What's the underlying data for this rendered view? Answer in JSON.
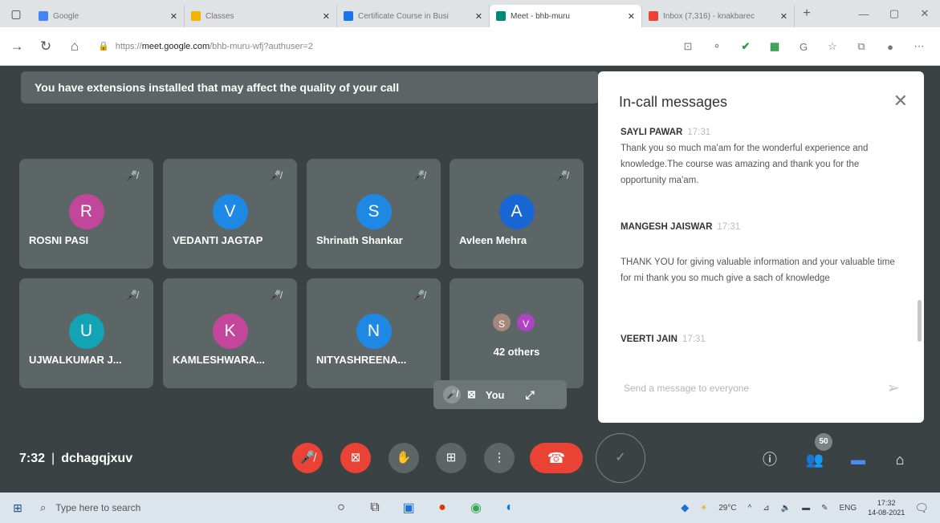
{
  "browser": {
    "tabs": [
      {
        "label": "Google",
        "color": "#4285f4",
        "active": false
      },
      {
        "label": "Classes",
        "color": "#f4b400",
        "active": false
      },
      {
        "label": "Certificate Course in Busi",
        "color": "#1a73e8",
        "active": false
      },
      {
        "label": "Meet - bhb-muru",
        "color": "#00897b",
        "active": true
      },
      {
        "label": "Inbox (7,316) - knakbarec",
        "color": "#ea4335",
        "active": false
      }
    ],
    "new_tab_label": "+",
    "url_prefix": "https://",
    "url_host": "meet.google.com",
    "url_path": "/bhb-muru-wfj?authuser=2"
  },
  "meet": {
    "extension_warning": "You have extensions installed that may affect the quality of your call",
    "participants": [
      {
        "initial": "R",
        "name": "ROSNI PASI",
        "color": "#c2479a"
      },
      {
        "initial": "V",
        "name": "VEDANTI JAGTAP",
        "color": "#1e88e5"
      },
      {
        "initial": "S",
        "name": "Shrinath Shankar",
        "color": "#1e88e5"
      },
      {
        "initial": "A",
        "name": "Avleen Mehra",
        "color": "#1967d2"
      },
      {
        "initial": "U",
        "name": "UJWALKUMAR J...",
        "color": "#12a4b4"
      },
      {
        "initial": "K",
        "name": "KAMLESHWARA...",
        "color": "#c2479a"
      },
      {
        "initial": "N",
        "name": "NITYASHREENA...",
        "color": "#1e88e5"
      }
    ],
    "others": {
      "avatars": [
        {
          "initial": "S",
          "color": "#a6877a"
        },
        {
          "initial": "V",
          "color": "#b042c4"
        }
      ],
      "label": "42 others"
    },
    "self_label": "You",
    "time": "7:32",
    "meeting_code": "dchagqjxuv",
    "people_count": "50"
  },
  "chat": {
    "title": "In-call messages",
    "messages": [
      {
        "sender": "SAYLI PAWAR",
        "time": "17:31",
        "text": "Thank you so much ma'am for the wonderful experience and knowledge.The course was amazing and thank you for the opportunity ma'am."
      },
      {
        "sender": "MANGESH JAISWAR",
        "time": "17:31",
        "text": ""
      },
      {
        "sender": "",
        "time": "",
        "text": "THANK YOU for giving valuable information  and your valuable time for mi thank you so much give a sach of knowledge"
      },
      {
        "sender": "VEERTI JAIN",
        "time": "17:31",
        "text": ""
      }
    ],
    "compose_placeholder": "Send a message to everyone"
  },
  "taskbar": {
    "search_placeholder": "Type here to search",
    "temperature": "29°C",
    "language": "ENG",
    "clock_time": "17:32",
    "clock_date": "14-08-2021"
  }
}
